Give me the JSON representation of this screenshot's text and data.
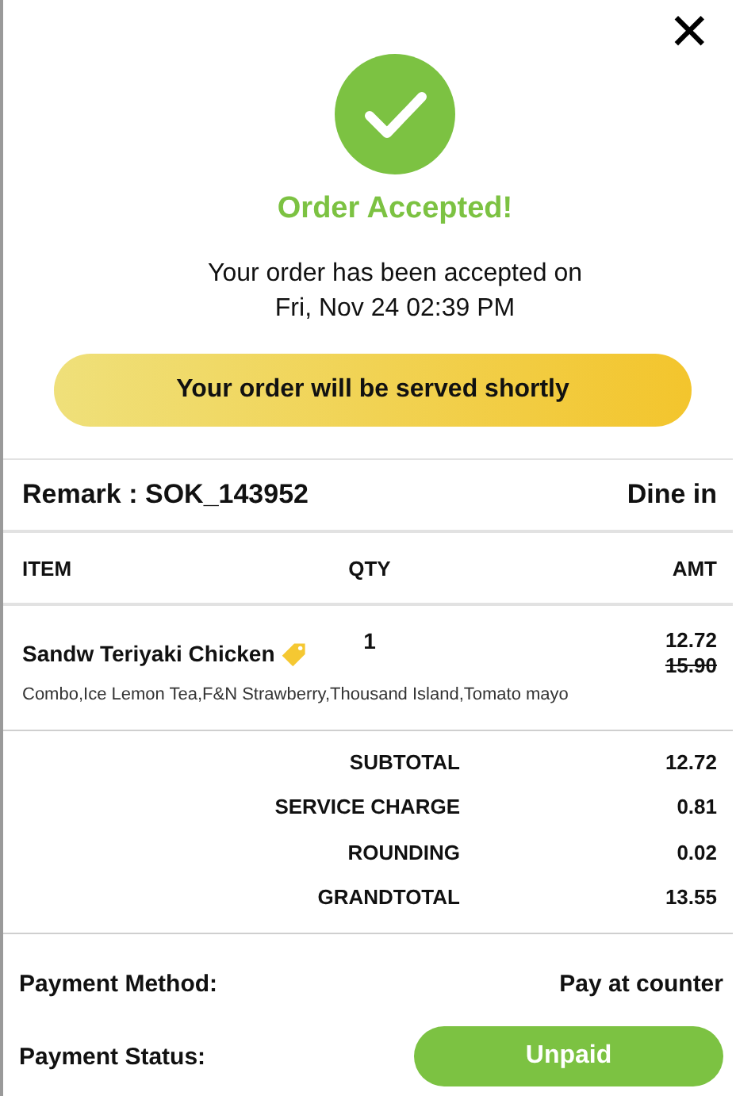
{
  "close_button": {
    "label": "✕"
  },
  "status": {
    "title": "Order Accepted!",
    "message_line_1": "Your order has been accepted on",
    "message_line_2": "Fri, Nov 24 02:39 PM",
    "banner": "Your order will be served shortly"
  },
  "order": {
    "remark": "Remark : SOK_143952",
    "dining_option": "Dine in"
  },
  "table": {
    "columns": [
      "ITEM",
      "QTY",
      "AMT"
    ],
    "rows": [
      {
        "name": "Sandw Teriyaki Chicken",
        "discounted": true,
        "qty": "1",
        "amount": "12.72",
        "original_amount": "15.90",
        "modifiers": "Combo,Ice Lemon Tea,F&N Strawberry,Thousand Island,Tomato mayo"
      }
    ]
  },
  "totals": [
    {
      "label": "SUBTOTAL",
      "value": "12.72"
    },
    {
      "label": "SERVICE CHARGE",
      "value": "0.81"
    },
    {
      "label": "ROUNDING",
      "value": "0.02"
    },
    {
      "label": "GRANDTOTAL",
      "value": "13.55"
    }
  ],
  "payment": {
    "method_label": "Payment Method:",
    "method": "Pay at counter",
    "status_label": "Payment Status:",
    "status": "Unpaid"
  }
}
